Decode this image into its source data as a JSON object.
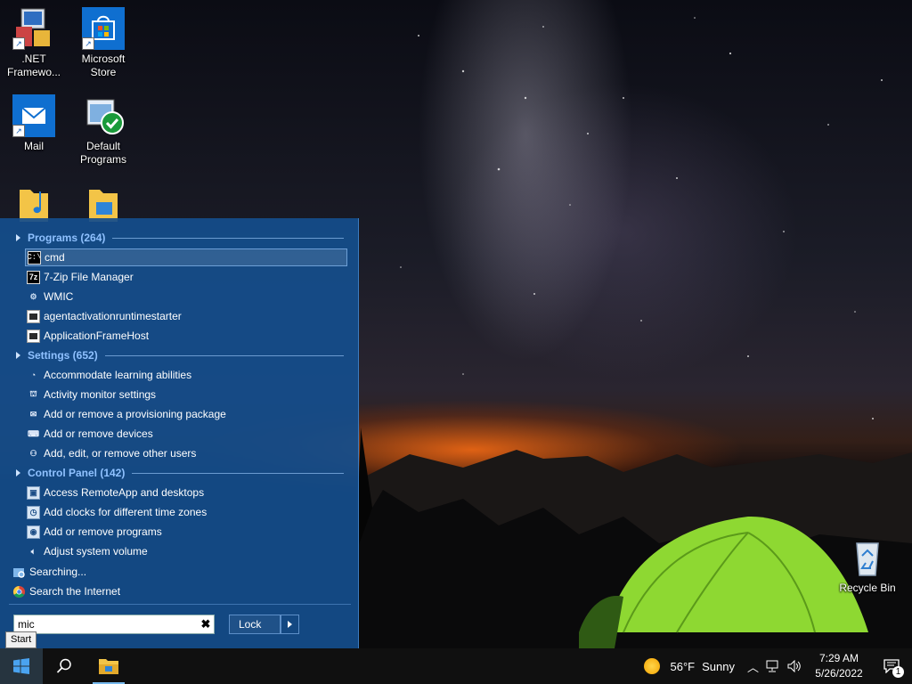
{
  "desktop": {
    "icons": [
      {
        "name": "dotnet-framework-icon",
        "label": ".NET\nFramewo..."
      },
      {
        "name": "microsoft-store-icon",
        "label": "Microsoft\nStore"
      },
      {
        "name": "mail-icon",
        "label": "Mail"
      },
      {
        "name": "default-programs-icon",
        "label": "Default\nPrograms"
      },
      {
        "name": "recycle-bin-icon",
        "label": "Recycle Bin"
      }
    ]
  },
  "start_menu": {
    "groups": [
      {
        "header": "Programs (264)",
        "items": [
          {
            "label": "cmd",
            "icon": "cmd-icon"
          },
          {
            "label": "7-Zip File Manager",
            "icon": "7zip-icon"
          },
          {
            "label": "WMIC",
            "icon": "wmic-icon"
          },
          {
            "label": "agentactivationruntimestarter",
            "icon": "app-icon"
          },
          {
            "label": "ApplicationFrameHost",
            "icon": "app-icon"
          }
        ]
      },
      {
        "header": "Settings (652)",
        "items": [
          {
            "label": "Accommodate learning abilities",
            "icon": "ease-of-access-icon"
          },
          {
            "label": "Activity monitor settings",
            "icon": "activity-monitor-icon"
          },
          {
            "label": "Add or remove a provisioning package",
            "icon": "provisioning-package-icon"
          },
          {
            "label": "Add or remove devices",
            "icon": "devices-icon"
          },
          {
            "label": "Add, edit, or remove other users",
            "icon": "user-icon"
          }
        ]
      },
      {
        "header": "Control Panel (142)",
        "items": [
          {
            "label": "Access RemoteApp and desktops",
            "icon": "remoteapp-icon"
          },
          {
            "label": "Add clocks for different time zones",
            "icon": "clock-icon"
          },
          {
            "label": "Add or remove programs",
            "icon": "programs-icon"
          },
          {
            "label": "Adjust system volume",
            "icon": "volume-icon"
          }
        ]
      }
    ],
    "searching_label": "Searching...",
    "search_internet_label": "Search the Internet",
    "search": {
      "value": "mic",
      "placeholder": ""
    },
    "lock_label": "Lock",
    "start_tooltip": "Start"
  },
  "taskbar": {
    "weather": {
      "temperature": "56°F",
      "condition": "Sunny"
    },
    "clock": {
      "time": "7:29 AM",
      "date": "5/26/2022"
    },
    "notification_count": "1"
  },
  "colors": {
    "start_menu_bg": "#144e8c",
    "group_header": "#8fc1ff",
    "taskbar_bg": "#101010"
  }
}
